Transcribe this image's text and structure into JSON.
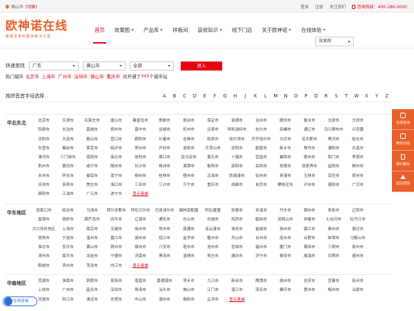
{
  "topbar": {
    "location": "佛山市",
    "switch": "[切换]",
    "login": "登录",
    "register": "注册",
    "follow": "关注我们",
    "hotline": "咨询热线：400-186-0000"
  },
  "logo": {
    "name": "欧神诺在线",
    "slogan": "最睡觉家的整体解决方案"
  },
  "nav": [
    {
      "label": "首页",
      "active": true,
      "dd": false
    },
    {
      "label": "效果图",
      "dd": true
    },
    {
      "label": "产品库",
      "dd": true
    },
    {
      "label": "样板间",
      "dd": false
    },
    {
      "label": "装修知识",
      "dd": true
    },
    {
      "label": "线下门店",
      "dd": false
    },
    {
      "label": "关于欧神诺",
      "dd": true
    },
    {
      "label": "在线体验",
      "dd": true
    }
  ],
  "nav_search": "效果图",
  "search": {
    "label": "快速查找",
    "province": "广东",
    "city": "佛山市",
    "district": "全部",
    "enter": "进入",
    "hot_label": "热门城市",
    "hot_cities": [
      "北京市",
      "上海市",
      "广州市",
      "深圳市",
      "佛山市",
      "重庆市"
    ],
    "total_prefix": "共开通了",
    "total_count": "345",
    "total_suffix": "个城市站"
  },
  "letters": {
    "label": "按拼音首字母选择",
    "items": [
      "A",
      "B",
      "C",
      "D",
      "E",
      "F",
      "G",
      "H",
      "J",
      "K",
      "L",
      "M",
      "N",
      "O",
      "P",
      "Q",
      "R",
      "S",
      "T",
      "W",
      "X",
      "Y",
      "Z"
    ]
  },
  "regions": [
    {
      "name": "华北东北",
      "cities": [
        "北京市",
        "天津市",
        "石家庄市",
        "唐山市",
        "秦皇岛市",
        "邯郸市",
        "邢台市",
        "保定市",
        "承德市",
        "沧州市",
        "廊坊市",
        "衡水市",
        "太原市",
        "大同市",
        "阳泉市",
        "长治市",
        "晋城市",
        "朔州市",
        "晋中市",
        "运城市",
        "忻州市",
        "吕梁市",
        "呼和浩特市",
        "包头市",
        "赤峰市",
        "通辽市",
        "乌兰察布市",
        "兴安盟",
        "沈阳市",
        "大连市",
        "鞍山市",
        "营口市",
        "朝阳市",
        "长春市",
        "吉林市",
        "松原市",
        "哈尔滨市",
        "齐齐哈尔市",
        "大庆市",
        "佳木斯市",
        "黑河市",
        "绥化市",
        "东营市",
        "烟台市",
        "莱芜市",
        "临沂市",
        "郑州市",
        "开封市",
        "洛阳市",
        "平顶山市",
        "安阳市",
        "鹤壁市",
        "新乡市",
        "焦作市",
        "濮阳市",
        "许昌市",
        "漯河市",
        "三门峡市",
        "南阳市",
        "商丘市",
        "信阳市",
        "周口市",
        "驻马店市",
        "黄石市",
        "十堰市",
        "宜昌市",
        "襄阳市",
        "鄂州市",
        "荆门市",
        "孝感市",
        "荆州市",
        "黄冈市",
        "咸宁市",
        "随州市",
        "长沙市",
        "株洲市",
        "湘潭市",
        "衡阳市",
        "邵阳市",
        "岳阳市",
        "常德市",
        "张家界市",
        "益阳市",
        "郴州市",
        "永州市",
        "怀化市",
        "娄底市",
        "南宁市",
        "柳州市",
        "桂林市",
        "梧州市",
        "北海市",
        "防城港市",
        "钦州市",
        "贵港市",
        "玉林市",
        "百色市",
        "贺州市",
        "河池市",
        "来宾市",
        "崇左市",
        "海口市",
        "三亚市",
        "三沙市",
        "万宁市",
        "重庆市",
        "成都市",
        "自贡市",
        "攀枝花市",
        "泸州市",
        "德阳市",
        "广汉市",
        "绵阳市",
        "江油市",
        "广元市",
        "遂宁市",
        "显示县城"
      ]
    },
    {
      "name": "华东地区",
      "cities": [
        "张家口市",
        "临汾市",
        "乌海市",
        "鄂尔多斯市",
        "呼伦贝尔市",
        "巴彦淖尔市",
        "锡林郭勒盟",
        "阿拉善盟",
        "抚顺市",
        "本溪市",
        "丹东市",
        "锦州市",
        "阜新市",
        "辽阳市",
        "盘锦市",
        "铁岭市",
        "葫芦岛市",
        "四平市",
        "辽源市",
        "通化市",
        "白山市",
        "白城市",
        "鸡西市",
        "鹤岗市",
        "双鸭山市",
        "伊春市",
        "七台河市",
        "牡丹江市",
        "大兴安岭地区",
        "上海市",
        "南京市",
        "无锡市",
        "徐州市",
        "常州市",
        "南通市",
        "连云港市",
        "淮安市",
        "盐城市",
        "扬州市",
        "镇江市",
        "泰州市",
        "宿迁市",
        "常熟市",
        "宁波市",
        "温州市",
        "嘉兴市",
        "湖州市",
        "绍兴市",
        "金华市",
        "衢州市",
        "舟山市",
        "台州市",
        "丽水市",
        "合肥市",
        "蚌埠市",
        "马鞍山市",
        "淮北市",
        "安庆市",
        "黄山市",
        "滁州市",
        "宿州市",
        "六安市",
        "亳州市",
        "池州市",
        "宣城市",
        "福州市",
        "厦门市",
        "莆田市",
        "三明市",
        "泉州市",
        "漳州市",
        "南平市",
        "龙岩市",
        "宁德市",
        "济南市",
        "青岛市",
        "淄博市",
        "枣庄市",
        "潍坊市",
        "济宁市",
        "泰安市",
        "威海市",
        "日照市",
        "德州市",
        "聊城市",
        "滨州市",
        "菏泽市",
        "内江市",
        "显示县城"
      ]
    },
    {
      "name": "华南地区",
      "cities": [
        "芜湖市",
        "淮南市",
        "铜陵市",
        "阜阳市",
        "南昌市",
        "景德镇市",
        "萍乡市",
        "九江市",
        "新余市",
        "鹰潭市",
        "赣州市",
        "吉安市",
        "宜春市",
        "抚州市",
        "上饶市",
        "广州市",
        "韶关市",
        "深圳市",
        "珠海市",
        "汕头市",
        "佛山市",
        "江门市",
        "湛江市",
        "茂名市",
        "肇庆市",
        "惠州市",
        "梅州市",
        "汕尾市",
        "河源市",
        "阳江市",
        "清远市",
        "东莞市",
        "中山市",
        "潮州市",
        "揭阳市",
        "云浮市",
        "显示县城"
      ]
    }
  ],
  "side": [
    {
      "label": "在线咨询",
      "icon": "chat-icon"
    },
    {
      "label": "微信在线",
      "icon": "wechat-icon"
    },
    {
      "label": "预约量房",
      "icon": "phone-icon"
    },
    {
      "label": "返回顶部",
      "icon": "arrow-up-icon"
    }
  ],
  "chat_widget": "在线咨询",
  "colors": {
    "accent": "#e60012",
    "brand": "#e8602a"
  }
}
